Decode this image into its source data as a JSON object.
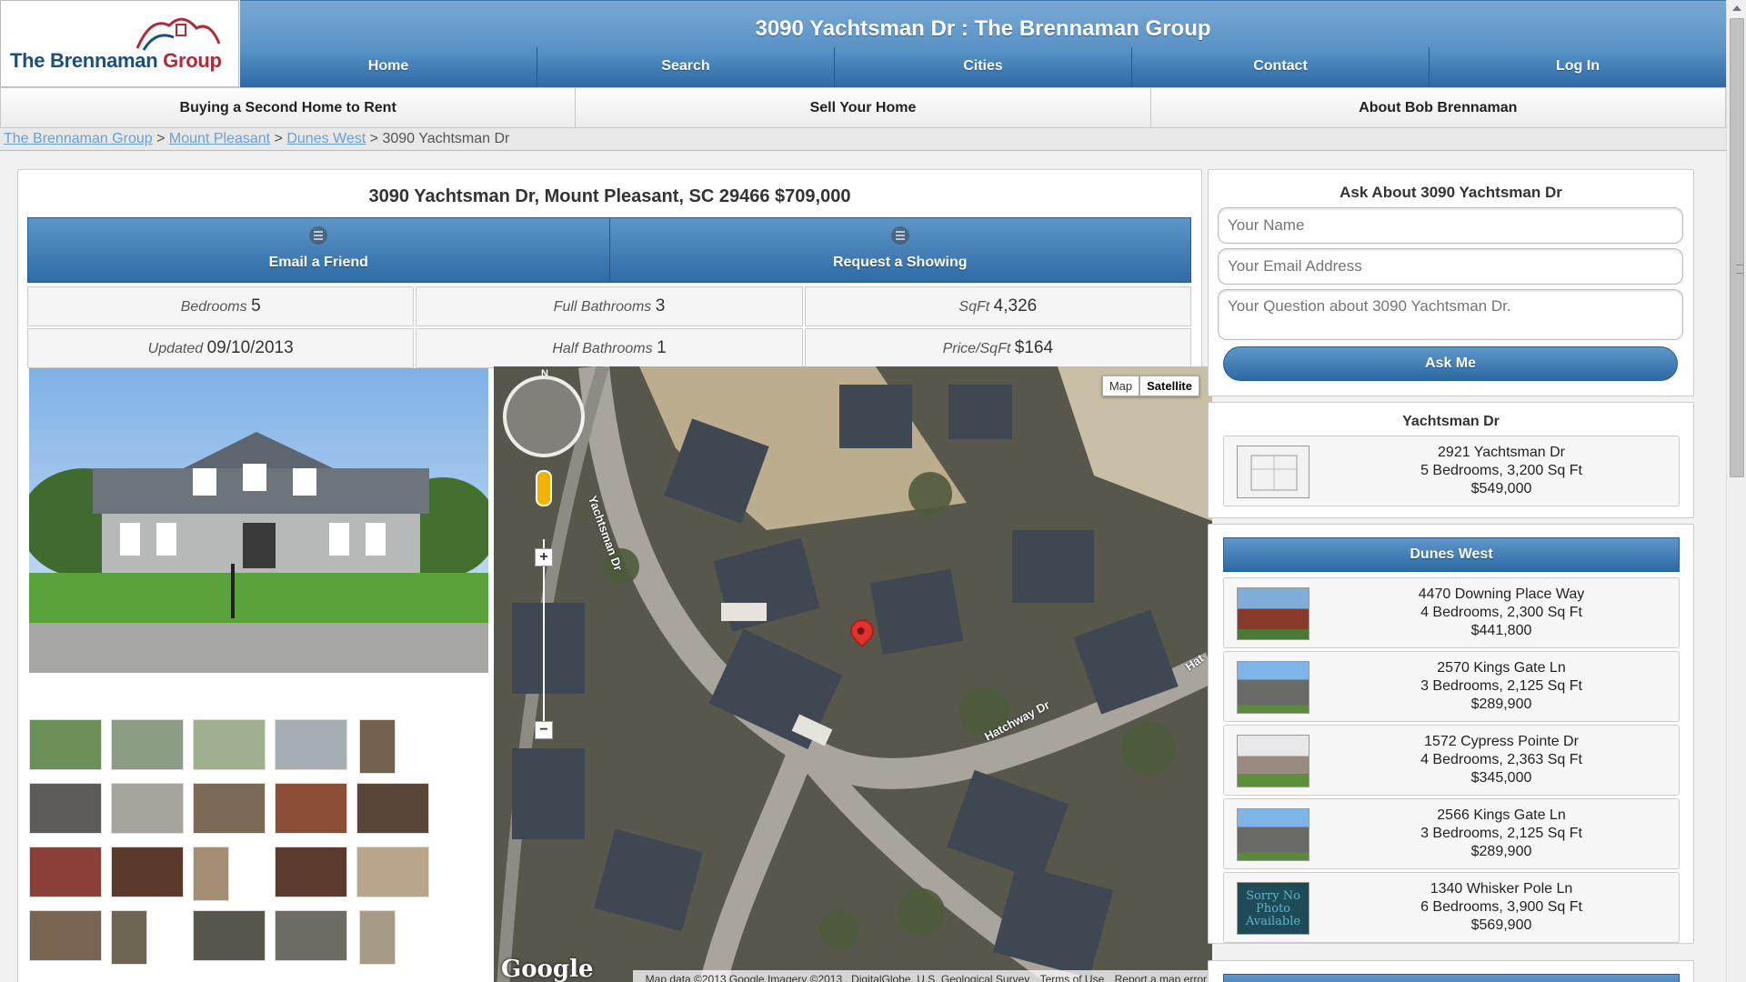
{
  "header": {
    "logo_text_1": "The Brennaman ",
    "logo_text_2": "Group",
    "title": "3090 Yachtsman Dr : The Brennaman Group"
  },
  "nav": [
    {
      "label": "Home"
    },
    {
      "label": "Search"
    },
    {
      "label": "Cities"
    },
    {
      "label": "Contact"
    },
    {
      "label": "Log In"
    }
  ],
  "subnav": [
    {
      "label": "Buying a Second Home to Rent"
    },
    {
      "label": "Sell Your Home"
    },
    {
      "label": "About Bob Brennaman"
    }
  ],
  "breadcrumb": {
    "crumb_1": "The Brennaman Group",
    "crumb_2": "Mount Pleasant",
    "crumb_3": "Dunes West",
    "current": "3090 Yachtsman Dr",
    "separator": ">"
  },
  "listing": {
    "title": "3090 Yachtsman Dr, Mount Pleasant, SC 29466 $709,000",
    "email_friend_label": "Email a Friend",
    "request_showing_label": "Request a Showing",
    "stats": {
      "bedrooms_label": "Bedrooms",
      "bedrooms": "5",
      "full_baths_label": "Full Bathrooms",
      "full_baths": "3",
      "sqft_label": "SqFt",
      "sqft": "4,326",
      "updated_label": "Updated",
      "updated": "09/10/2013",
      "half_baths_label": "Half Bathrooms",
      "half_baths": "1",
      "price_sqft_label": "Price/SqFt",
      "price_sqft": "$164"
    }
  },
  "map": {
    "map_label": "Map",
    "satellite_label": "Satellite",
    "compass_label": "N",
    "street_1": "Yachtsman Dr",
    "street_2": "Hatchway Dr",
    "street_3": "Hat",
    "logo": "Google",
    "attribution": "Map data ©2013 Google Imagery ©2013 , DigitalGlobe, U.S. Geological Survey",
    "terms": "Terms of Use",
    "report": "Report a map error",
    "zoom_in": "+",
    "zoom_out": "−"
  },
  "ask": {
    "title": "Ask About 3090 Yachtsman Dr",
    "name_placeholder": "Your Name",
    "email_placeholder": "Your Email Address",
    "question_placeholder": "Your Question about 3090 Yachtsman Dr.",
    "button_label": "Ask Me"
  },
  "street_listings": {
    "heading": "Yachtsman Dr",
    "items": [
      {
        "address": "2921 Yachtsman Dr",
        "details": "5 Bedrooms, 3,200 Sq Ft",
        "price": "$549,000"
      }
    ]
  },
  "dunes_west": {
    "heading": "Dunes West",
    "no_photo_text": "Sorry No Photo Available",
    "items": [
      {
        "address": "4470 Downing Place Way",
        "details": "4 Bedrooms, 2,300 Sq Ft",
        "price": "$441,800"
      },
      {
        "address": "2570 Kings Gate Ln",
        "details": "3 Bedrooms, 2,125 Sq Ft",
        "price": "$289,900"
      },
      {
        "address": "1572 Cypress Pointe Dr",
        "details": "4 Bedrooms, 2,363 Sq Ft",
        "price": "$345,000"
      },
      {
        "address": "2566 Kings Gate Ln",
        "details": "3 Bedrooms, 2,125 Sq Ft",
        "price": "$289,900"
      },
      {
        "address": "1340 Whisker Pole Ln",
        "details": "6 Bedrooms, 3,900 Sq Ft",
        "price": "$569,900"
      }
    ]
  },
  "colors": {
    "primary_blue": "#2d6aa5",
    "title_blue": "#5b93c6",
    "link": "#6aa0d6",
    "logo_navy": "#1c4f7c",
    "logo_red": "#b32b36"
  }
}
